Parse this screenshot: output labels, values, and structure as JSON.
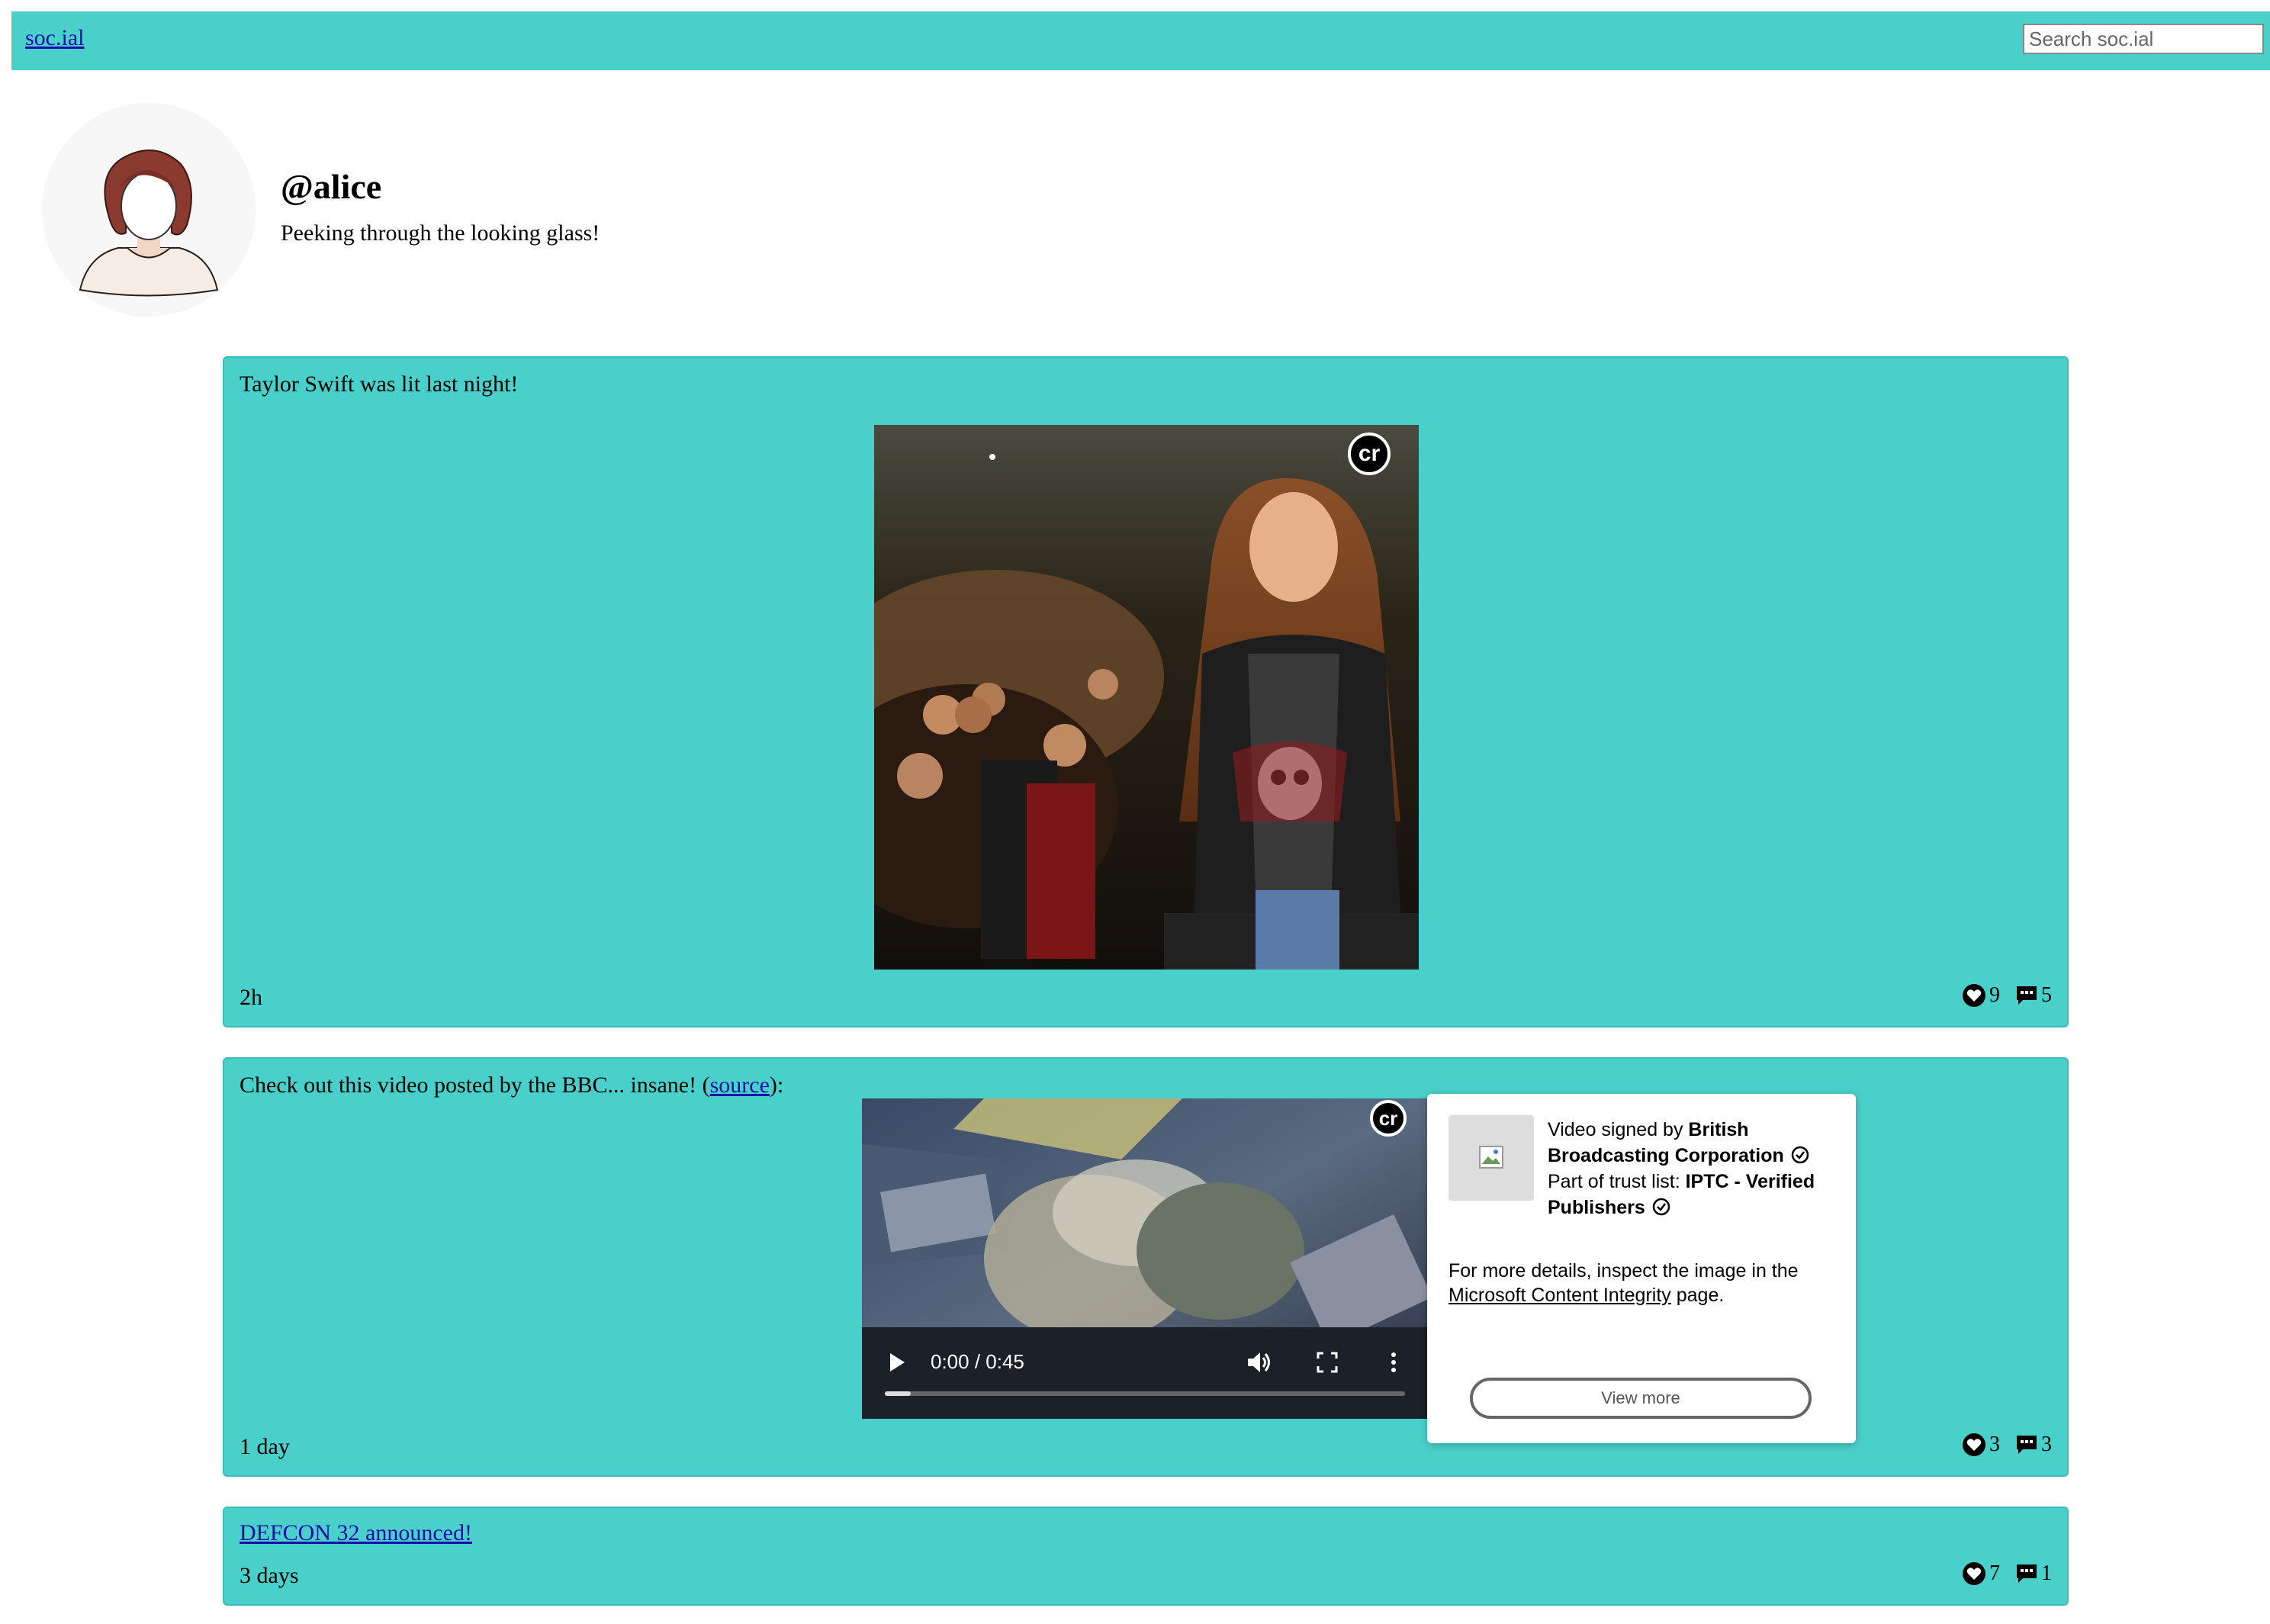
{
  "header": {
    "brand": "soc.ial",
    "search_placeholder": "Search soc.ial"
  },
  "profile": {
    "handle": "@alice",
    "bio": "Peeking through the looking glass!"
  },
  "posts": [
    {
      "text": "Taylor Swift was lit last night!",
      "time": "2h",
      "likes": "9",
      "comments": "5",
      "media": "image",
      "badge": "cr"
    },
    {
      "text_before": "Check out this video posted by the BBC... insane! (",
      "link": "source",
      "text_after": "):",
      "time": "1 day",
      "likes": "3",
      "comments": "3",
      "media": "video",
      "badge": "cr",
      "video": {
        "time": "0:00 / 0:45",
        "progress": 0.05
      }
    },
    {
      "link": "DEFCON 32 announced!",
      "time": "3 days",
      "likes": "7",
      "comments": "1"
    }
  ],
  "popup": {
    "line1_prefix": "Video signed by ",
    "line1_signer": "British Broadcasting Corporation",
    "line2_prefix": "Part of trust list: ",
    "line2_list": "IPTC - Verified Publishers",
    "details_prefix": "For more details, inspect the image in the ",
    "details_link": "Microsoft Content Integrity",
    "details_suffix": " page.",
    "button": "View more"
  },
  "colors": {
    "accent": "#49d0ca",
    "link": "#1a0dab"
  }
}
